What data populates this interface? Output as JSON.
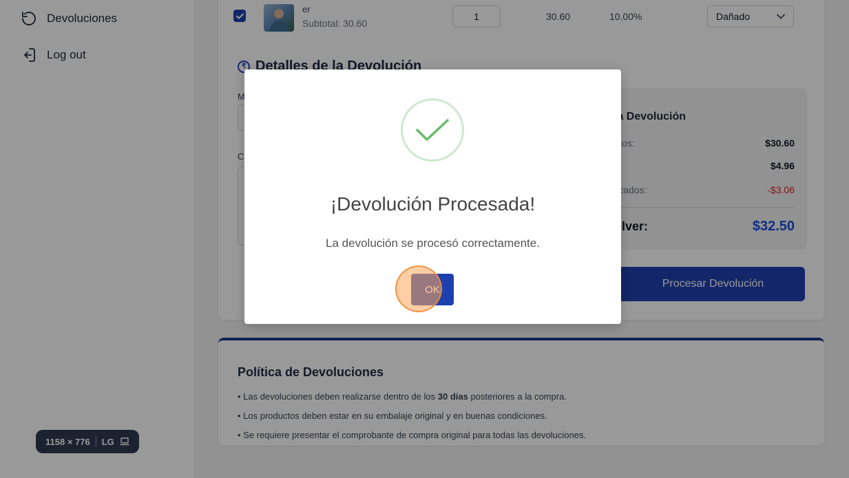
{
  "sidebar": {
    "items": [
      {
        "label": "Devoluciones",
        "icon": "rotate-ccw-icon"
      },
      {
        "label": "Log out",
        "icon": "log-out-icon"
      }
    ],
    "size_badge": {
      "dimensions": "1158 × 776",
      "breakpoint": "LG",
      "icon": "laptop-icon"
    }
  },
  "product_row": {
    "checked": true,
    "name_fragment": "er",
    "subtotal": "Subtotal: 30.60",
    "quantity": "1",
    "price": "30.60",
    "discount": "10.00%",
    "reason": "Dañado"
  },
  "details": {
    "title_visible": "Detalles de la Devolución",
    "label_m_fragment": "M",
    "label_c_fragment": "C"
  },
  "summary": {
    "title_fragment": "la Devolución",
    "rows": [
      {
        "label": "ctos:",
        "value": "$30.60",
        "negative": false
      },
      {
        "label": "",
        "value": "$4.96",
        "negative": false
      },
      {
        "label": "licados:",
        "value": "-$3.06",
        "negative": true
      }
    ],
    "total_label_fragment": "olver:",
    "total_value": "$32.50"
  },
  "process_button_fragment": "Procesar Devolución",
  "policy": {
    "title": "Política de Devoluciones",
    "item1_pre": "• Las devoluciones deben realizarse dentro de los ",
    "item1_bold": "30 días",
    "item1_post": " posteriores a la compra.",
    "item2": "• Los productos deben estar en su embalaje original y en buenas condiciones.",
    "item3": "• Se requiere presentar el comprobante de compra original para todas las devoluciones."
  },
  "modal": {
    "title": "¡Devolución Procesada!",
    "message": "La devolución se procesó correctamente.",
    "ok_label": "OK",
    "icon": "success-check-icon"
  },
  "colors": {
    "primary": "#1e40af",
    "success": "#4caf50",
    "negative": "#dc2626",
    "total": "#1d4ed8"
  }
}
